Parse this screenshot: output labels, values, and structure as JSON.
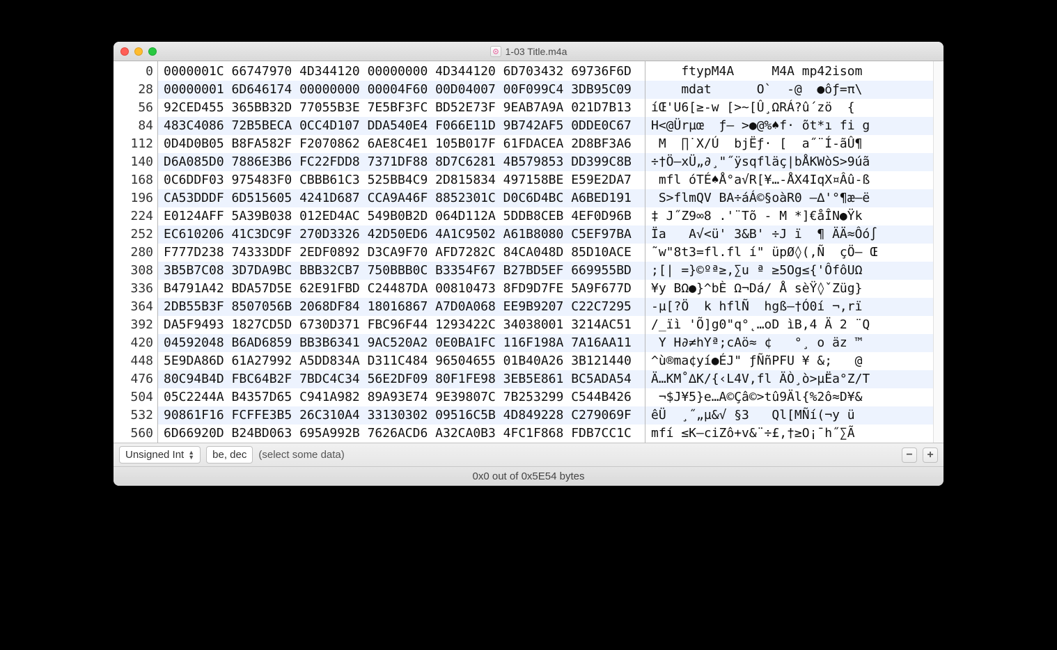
{
  "window": {
    "title": "1-03 Title.m4a"
  },
  "offsets": [
    "0",
    "28",
    "56",
    "84",
    "112",
    "140",
    "168",
    "196",
    "224",
    "252",
    "280",
    "308",
    "336",
    "364",
    "392",
    "420",
    "448",
    "476",
    "504",
    "532",
    "560"
  ],
  "hex_rows": [
    "0000001C 66747970 4D344120 00000000 4D344120 6D703432 69736F6D",
    "00000001 6D646174 00000000 00004F60 00D04007 00F099C4 3DB95C09",
    "92CED455 365BB32D 77055B3E 7E5BF3FC BD52E73F 9EAB7A9A 021D7B13",
    "483C4086 72B5BECA 0CC4D107 DDA540E4 F066E11D 9B742AF5 0DDE0C67",
    "0D4D0B05 B8FA582F F2070862 6AE8C4E1 105B017F 61FDACEA 2D8BF3A6",
    "D6A085D0 7886E3B6 FC22FDD8 7371DF88 8D7C6281 4B579853 DD399C8B",
    "0C6DDF03 975483F0 CBBB61C3 525BB4C9 2D815834 497158BE E59E2DA7",
    "CA53DDDF 6D515605 4241D687 CCA9A46F 8852301C D0C6D4BC A6BED191",
    "E0124AFF 5A39B038 012ED4AC 549B0B2D 064D112A 5DDB8CEB 4EF0D96B",
    "EC610206 41C3DC9F 270D3326 42D50ED6 4A1C9502 A61B8080 C5EF97BA",
    "F777D238 74333DDF 2EDF0892 D3CA9F70 AFD7282C 84CA048D 85D10ACE",
    "3B5B7C08 3D7DA9BC BBB32CB7 750BBB0C B3354F67 B27BD5EF 669955BD",
    "B4791A42 BDA57D5E 62E91FBD C24487DA 00810473 8FD9D7FE 5A9F677D",
    "2DB55B3F 8507056B 2068DF84 18016867 A7D0A068 EE9B9207 C22C7295",
    "DA5F9493 1827CD5D 6730D371 FBC96F44 1293422C 34038001 3214AC51",
    "04592048 B6AD6859 BB3B6341 9AC520A2 0E0BA1FC 116F198A 7A16AA11",
    "5E9DA86D 61A27992 A5DD834A D311C484 96504655 01B40A26 3B121440",
    "80C94B4D FBC64B2F 7BDC4C34 56E2DF09 80F1FE98 3EB5E861 BC5ADA54",
    "05C2244A B4357D65 C941A982 89A93E74 9E39807C 7B253299 C544B426",
    "90861F16 FCFFE3B5 26C310A4 33130302 09516C5B 4D849228 C279069F",
    "6D66920D B24BD063 695A992B 7626ACD6 A32CA0B3 4FC1F868 FDB7CC1C"
  ],
  "ascii_rows": [
    "    ftypM4A     M4A mp42isom",
    "    mdat      O`  -@  ●ôƒ=π\\",
    "íŒ'U6[≥-w [>~[Û¸ΩRÁ?û´zö  {",
    "H<@Ürµœ  ƒ— >●@%♠f· õt*ı fi g",
    " M  ∏˙X/Ú  bjËƒ· [  a˝¨Í-ãÛ¶",
    "÷†Ö—xÜ„∂¸\"˝ÿsqfläç|bÅKWòS>9úã",
    " mfl óTÉ♠Å°a√R[¥…-ÅX4IqX¤Âû-ß",
    " S>flmQV BA÷áÁ©§oàR0 —∆'°¶æ—ë",
    "‡ J˝Z9∞8 .'¨Tõ - M *]€åÎN●Ÿk",
    "Ïa   A√<ü' 3&B' ÷J ï  ¶ ÄÄ≈Ôó∫",
    "˜w\"8t3=fl.fl í\" üpØ◊(,Ñ  çÖ— Œ",
    ";[| =}©ºª≥,∑u ª ≥5Og≤{'ÔfôUΩ",
    "¥y BΩ●}^bÈ Ω¬Dá/ Å sèŸ◊ˇZüg}",
    "-µ[?Ö  k hflÑ  hgß—†Ó0í ¬,rï",
    "/_ïì 'Õ]g0\"q°˛…oD ìB,4 Ä 2 ¨Q",
    " Y H∂≠hYª;cAö≈ ¢   °¸ o äz ™",
    "^ù®ma¢yí●ÉJ\" ƒÑñPFU ¥ &;   @",
    "Ä…KM˚∆K/{‹L4V,fl ÄÒ¸ò>µËa°Z/T",
    " ¬$J¥5}e…A©Çâ©>tû9Äl{%2ô≈D¥&",
    "êÜ  ¸˝„µ&√ §3   Ql[MÑí(¬y ü",
    "mfí ≤K—ciZô+v&¨÷£,†≥O¡¯h˝∑Ã"
  ],
  "footer": {
    "type_selector": "Unsigned Int",
    "format_selector": "be, dec",
    "hint": "(select some data)"
  },
  "status": "0x0 out of 0x5E54 bytes"
}
